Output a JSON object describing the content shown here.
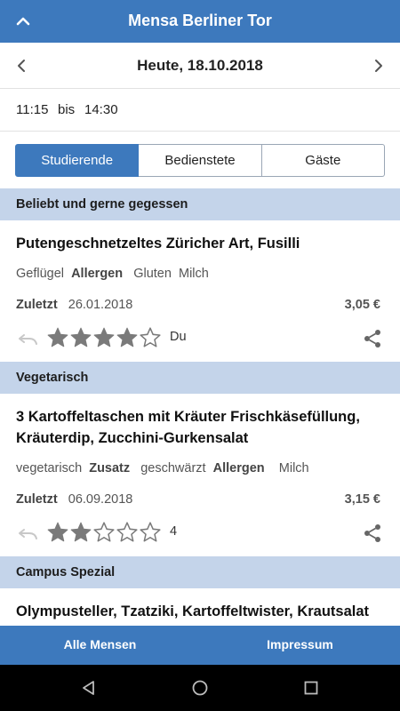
{
  "appbar": {
    "title": "Mensa Berliner Tor",
    "up_icon": "chevron-up-icon"
  },
  "date_nav": {
    "date": "Heute, 18.10.2018",
    "prev_icon": "chevron-left-icon",
    "next_icon": "chevron-right-icon"
  },
  "hours": {
    "from": "11:15",
    "sep": "bis",
    "to": "14:30"
  },
  "tabs": [
    {
      "label": "Studierende",
      "active": true
    },
    {
      "label": "Bedienstete",
      "active": false
    },
    {
      "label": "Gäste",
      "active": false
    }
  ],
  "sections": [
    {
      "title": "Beliebt und gerne gegessen",
      "meal": {
        "name": "Putengeschnetzeltes Züricher Art, Fusilli",
        "tags": [
          "Geflügel"
        ],
        "allergen_label": "Allergen",
        "allergens": [
          "Gluten",
          "Milch"
        ],
        "last_label": "Zuletzt",
        "last_date": "26.01.2018",
        "price": "3,05 €",
        "rating": 4,
        "rating_text": "Du"
      }
    },
    {
      "title": "Vegetarisch",
      "meal": {
        "name": "3 Kartoffeltaschen mit Kräuter Frischkäsefüllung, Kräuterdip, Zucchini-Gurkensalat",
        "tags": [
          "vegetarisch"
        ],
        "additive_label": "Zusatz",
        "additives": [
          "geschwärzt"
        ],
        "allergen_label": "Allergen",
        "allergens": [
          "Milch"
        ],
        "last_label": "Zuletzt",
        "last_date": "06.09.2018",
        "price": "3,15 €",
        "rating": 2,
        "rating_text": "4"
      }
    },
    {
      "title": "Campus Spezial",
      "meal": {
        "name": "Olympusteller, Tzatziki, Kartoffeltwister, Krautsalat"
      }
    }
  ],
  "bottom_nav": {
    "all": "Alle Mensen",
    "imprint": "Impressum"
  },
  "colors": {
    "primary": "#3d79bd",
    "section_bg": "#c4d4ea",
    "star": "#7a7a7a"
  }
}
